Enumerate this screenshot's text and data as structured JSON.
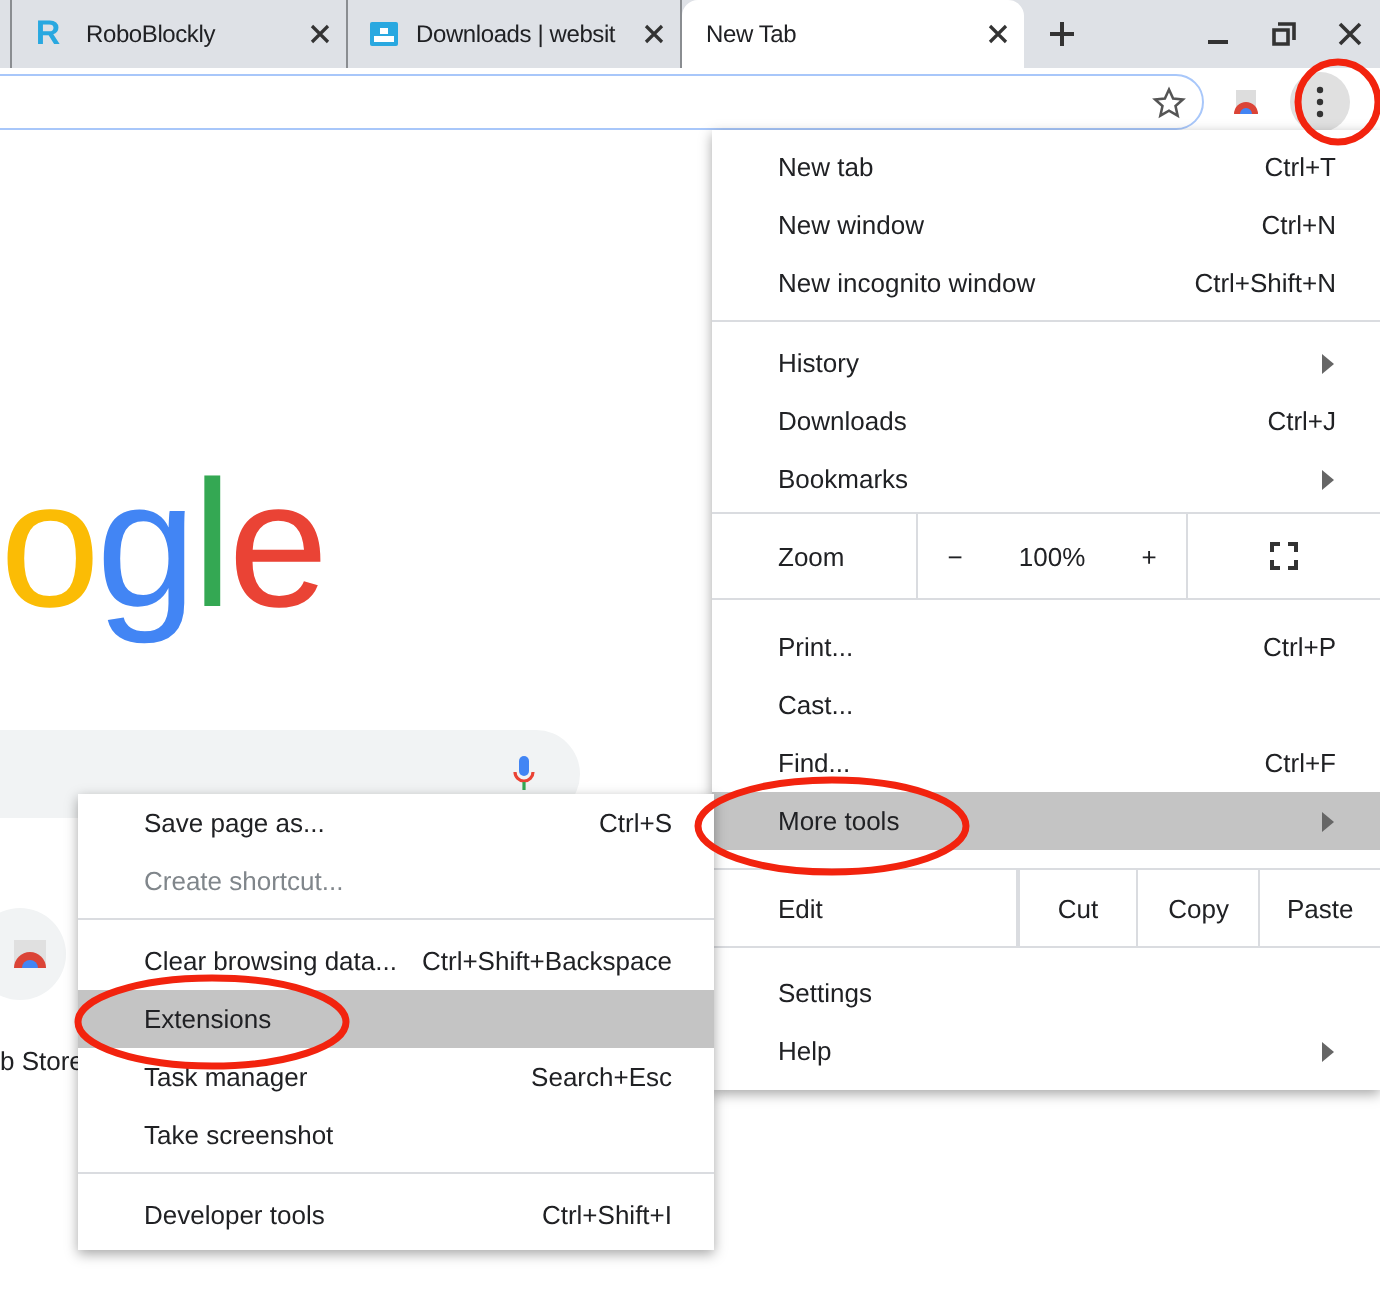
{
  "tabs": [
    {
      "kind": "lettered",
      "title": "RoboBlockly",
      "icon_text": "R",
      "selected": false
    },
    {
      "kind": "pictured",
      "title": "Downloads | websit",
      "selected": false
    },
    {
      "kind": "plain",
      "title": "New Tab",
      "selected": true
    }
  ],
  "page": {
    "logo": [
      {
        "char": "o",
        "color": "#fbbc05"
      },
      {
        "char": "g",
        "color": "#4285f4"
      },
      {
        "char": "l",
        "color": "#34a853"
      },
      {
        "char": "e",
        "color": "#ea4335"
      }
    ],
    "shortcut": {
      "caption": "b Store"
    }
  },
  "menu": {
    "items": [
      {
        "kind": "item",
        "label": "New tab",
        "shortcut": "Ctrl+T",
        "submenu": false,
        "selected": false
      },
      {
        "kind": "item",
        "label": "New window",
        "shortcut": "Ctrl+N",
        "submenu": false,
        "selected": false
      },
      {
        "kind": "item",
        "label": "New incognito window",
        "shortcut": "Ctrl+Shift+N",
        "submenu": false,
        "selected": false
      },
      {
        "kind": "separator"
      },
      {
        "kind": "item",
        "label": "History",
        "submenu": true,
        "selected": false
      },
      {
        "kind": "item",
        "label": "Downloads",
        "shortcut": "Ctrl+J",
        "submenu": false,
        "selected": false
      },
      {
        "kind": "item",
        "label": "Bookmarks",
        "submenu": true,
        "selected": false
      },
      {
        "kind": "zoom",
        "label": "Zoom",
        "minus": "−",
        "value": "100%",
        "plus": "+"
      },
      {
        "kind": "item",
        "label": "Print...",
        "shortcut": "Ctrl+P",
        "submenu": false,
        "selected": false
      },
      {
        "kind": "item",
        "label": "Cast...",
        "submenu": false,
        "selected": false
      },
      {
        "kind": "item",
        "label": "Find...",
        "shortcut": "Ctrl+F",
        "submenu": false,
        "selected": false
      },
      {
        "kind": "item",
        "label": "More tools",
        "submenu": true,
        "selected": true
      },
      {
        "kind": "edit",
        "label": "Edit",
        "buttons": [
          "Cut",
          "Copy",
          "Paste"
        ]
      },
      {
        "kind": "item",
        "label": "Settings",
        "submenu": false,
        "selected": false
      },
      {
        "kind": "item",
        "label": "Help",
        "submenu": true,
        "selected": false
      }
    ]
  },
  "more_tools": {
    "items": [
      {
        "kind": "item",
        "label": "Save page as...",
        "shortcut": "Ctrl+S",
        "selected": false,
        "disabled": false
      },
      {
        "kind": "item",
        "label": "Create shortcut...",
        "selected": false,
        "disabled": true
      },
      {
        "kind": "separator"
      },
      {
        "kind": "item",
        "label": "Clear browsing data...",
        "shortcut": "Ctrl+Shift+Backspace",
        "selected": false,
        "disabled": false
      },
      {
        "kind": "item",
        "label": "Extensions",
        "selected": true,
        "disabled": false
      },
      {
        "kind": "item",
        "label": "Task manager",
        "shortcut": "Search+Esc",
        "selected": false,
        "disabled": false
      },
      {
        "kind": "item",
        "label": "Take screenshot",
        "selected": false,
        "disabled": false
      },
      {
        "kind": "separator"
      },
      {
        "kind": "item",
        "label": "Developer tools",
        "shortcut": "Ctrl+Shift+I",
        "selected": false,
        "disabled": false
      }
    ]
  }
}
